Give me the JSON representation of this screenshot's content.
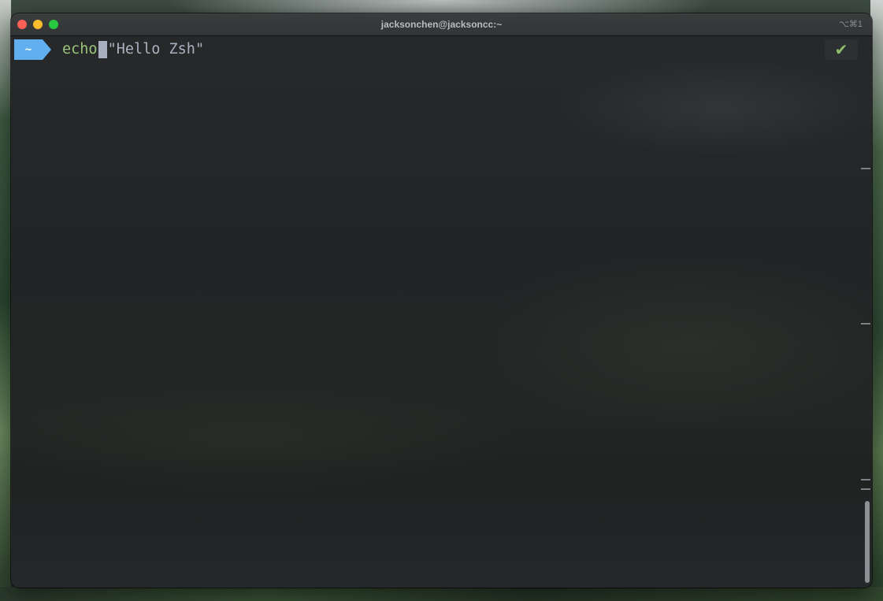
{
  "window": {
    "title": "jacksonchen@jacksoncc:~",
    "shortcut": "⌥⌘1"
  },
  "prompt": {
    "directory": "~",
    "command": "echo",
    "argument": "\"Hello Zsh\"",
    "status_icon": "✔"
  },
  "colors": {
    "directory_segment": "#61afef",
    "command": "#98c379",
    "argument": "#abb2bf",
    "status_ok": "#8fbc6a",
    "close": "#fe5f57",
    "minimize": "#febc2e",
    "zoom": "#28c840"
  }
}
